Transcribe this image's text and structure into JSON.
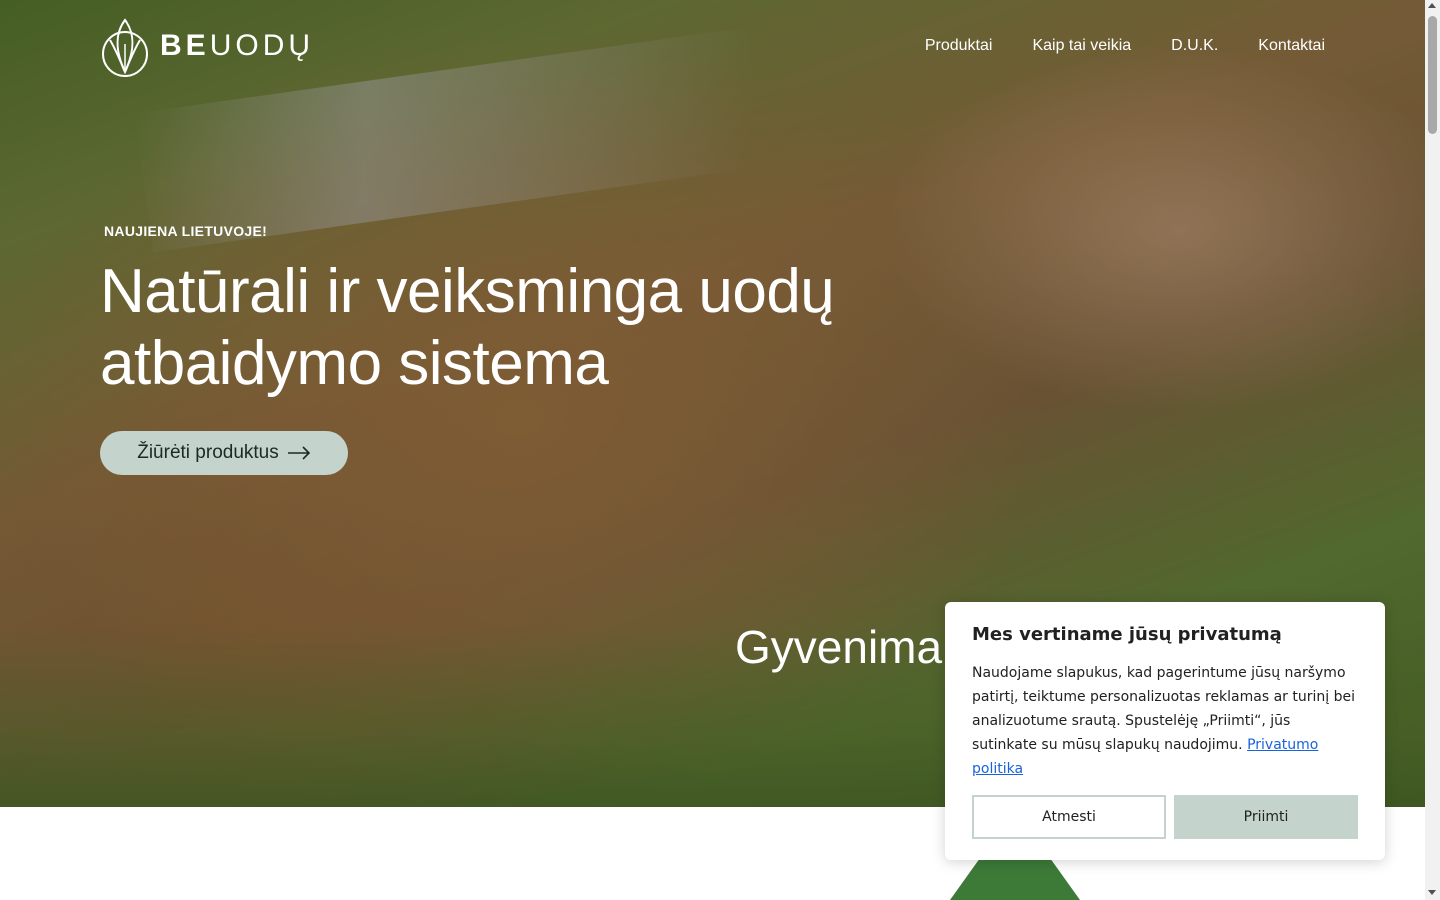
{
  "brand": {
    "logo_bold": "BE",
    "logo_rest": "UODŲ"
  },
  "nav": {
    "items": [
      {
        "label": "Produktai"
      },
      {
        "label": "Kaip tai veikia"
      },
      {
        "label": "D.U.K."
      },
      {
        "label": "Kontaktai"
      }
    ]
  },
  "hero": {
    "eyebrow": "NAUJIENA LIETUVOJE!",
    "headline": "Natūrali ir veiksminga uodų atbaidymo sistema",
    "cta_label": "Žiūrėti produktus",
    "cta_icon": "arrow-right-icon",
    "tagline": "Gyvenima"
  },
  "cookie_banner": {
    "title": "Mes vertiname jūsų privatumą",
    "text": "Naudojame slapukus, kad pagerintume jūsų naršymo patirtį, teiktume personalizuotas reklamas ar turinį bei analizuotume srautą. Spustelėję „Priimti“, jūs sutinkate su mūsų slapukų naudojimu.",
    "link_label": "Privatumo politika",
    "reject_label": "Atmesti",
    "accept_label": "Priimti"
  },
  "colors": {
    "accent": "#c5d3cd",
    "link": "#1863dc",
    "bottom_shape": "#3d7a38"
  }
}
